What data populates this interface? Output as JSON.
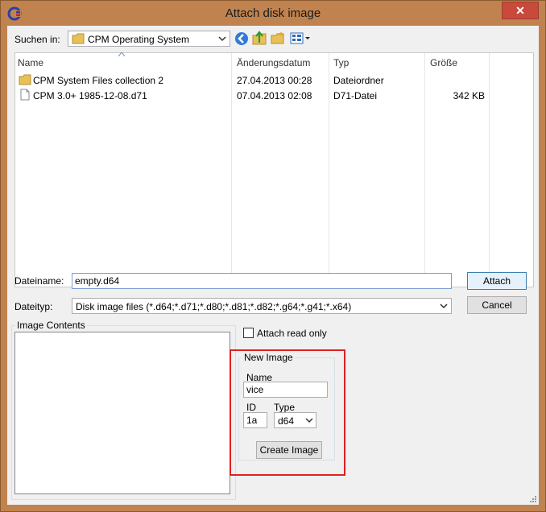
{
  "window": {
    "title": "Attach disk image",
    "close_label": "✕"
  },
  "lookin": {
    "label": "Suchen in:",
    "value": "CPM Operating System"
  },
  "toolbar": {
    "icons": [
      "back-icon",
      "up-folder-icon",
      "new-folder-icon",
      "view-menu-icon"
    ]
  },
  "filelist": {
    "headers": [
      "Name",
      "Änderungsdatum",
      "Typ",
      "Größe"
    ],
    "rows": [
      {
        "name": "CPM System Files  collection 2",
        "date": "27.04.2013 00:28",
        "type": "Dateiordner",
        "size": "",
        "icon": "folder-icon"
      },
      {
        "name": "CPM 3.0+ 1985-12-08.d71",
        "date": "07.04.2013 02:08",
        "type": "D71-Datei",
        "size": "342 KB",
        "icon": "file-icon"
      }
    ]
  },
  "filename": {
    "label": "Dateiname:",
    "value": "empty.d64"
  },
  "filetype": {
    "label": "Dateityp:",
    "value": "Disk image files (*.d64;*.d71;*.d80;*.d81;*.d82;*.g64;*.g41;*.x64)"
  },
  "buttons": {
    "attach": "Attach",
    "cancel": "Cancel"
  },
  "image_contents": {
    "label": "Image Contents"
  },
  "read_only": {
    "label": "Attach read only",
    "checked": false
  },
  "new_image": {
    "group_label": "New Image",
    "name_label": "Name",
    "name_value": "vice",
    "id_label": "ID",
    "id_value": "1a",
    "type_label": "Type",
    "type_value": "d64",
    "create_button": "Create Image"
  },
  "colors": {
    "frame": "#c0834f",
    "close_button": "#c74a3b",
    "highlight_box": "#e02020",
    "folder": "#e8c05a"
  }
}
